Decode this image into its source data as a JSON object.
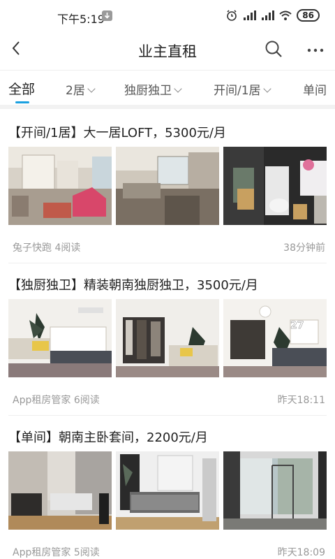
{
  "status_bar": {
    "time": "下午5:19",
    "battery": "86"
  },
  "header": {
    "title": "业主直租",
    "back_icon": "chevron-left-icon",
    "search_icon": "search-icon",
    "more_icon": "more-icon"
  },
  "tabs": [
    {
      "label": "全部",
      "active": true
    },
    {
      "label": "2居",
      "dropdown": true
    },
    {
      "label": "独厨独卫",
      "dropdown": true
    },
    {
      "label": "开间/1居",
      "dropdown": true
    },
    {
      "label": "单间"
    }
  ],
  "posts": [
    {
      "title": "【开间/1居】大一居LOFT，5300元/月",
      "author": "兔子快跑",
      "reads": "4阅读",
      "time": "38分钟前"
    },
    {
      "title": "【独厨独卫】精装朝南独厨独卫，3500元/月",
      "author": "App租房管家",
      "reads": "6阅读",
      "time": "昨天18:11",
      "photo_badge": "27"
    },
    {
      "title": "【单间】朝南主卧套间，2200元/月",
      "author": "App租房管家",
      "reads": "5阅读",
      "time": "昨天18:09"
    }
  ],
  "colors": {
    "accent": "#1aa0e0",
    "muted_text": "#999999"
  }
}
